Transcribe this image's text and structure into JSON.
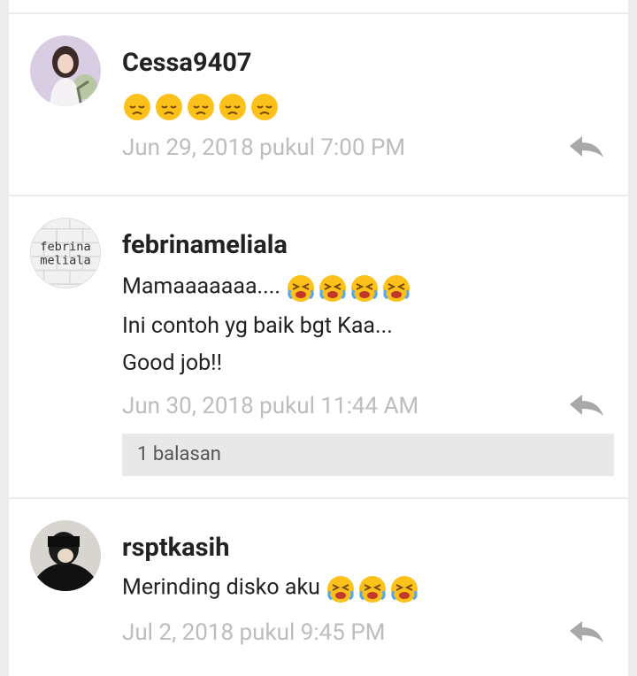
{
  "comments": [
    {
      "username": "Cessa9407",
      "text_lines": [],
      "emojis": {
        "type": "sad-face-emoji",
        "count": 5
      },
      "timestamp": "Jun 29, 2018 pukul 7:00 PM"
    },
    {
      "username": "febrinameliala",
      "avatar_text": "febrina\nmeliala",
      "text_lines": [
        "Mamaaaaaaa....",
        "Ini contoh yg baik bgt Kaa...",
        "Good job!!"
      ],
      "emojis": {
        "type": "crying-face-emoji",
        "count": 4
      },
      "timestamp": "Jun 30, 2018 pukul 11:44 AM",
      "replies_label": "1 balasan"
    },
    {
      "username": "rsptkasih",
      "text_lines": [
        "Merinding disko aku"
      ],
      "emojis": {
        "type": "crying-face-emoji",
        "count": 3
      },
      "timestamp": "Jul 2, 2018 pukul 9:45 PM"
    }
  ],
  "colors": {
    "page_bg": "#ececec",
    "card_bg": "#ffffff",
    "timestamp": "#bdbdbd",
    "reply_icon": "#a8a8a8",
    "emoji_yellow": "#fcc21b"
  }
}
